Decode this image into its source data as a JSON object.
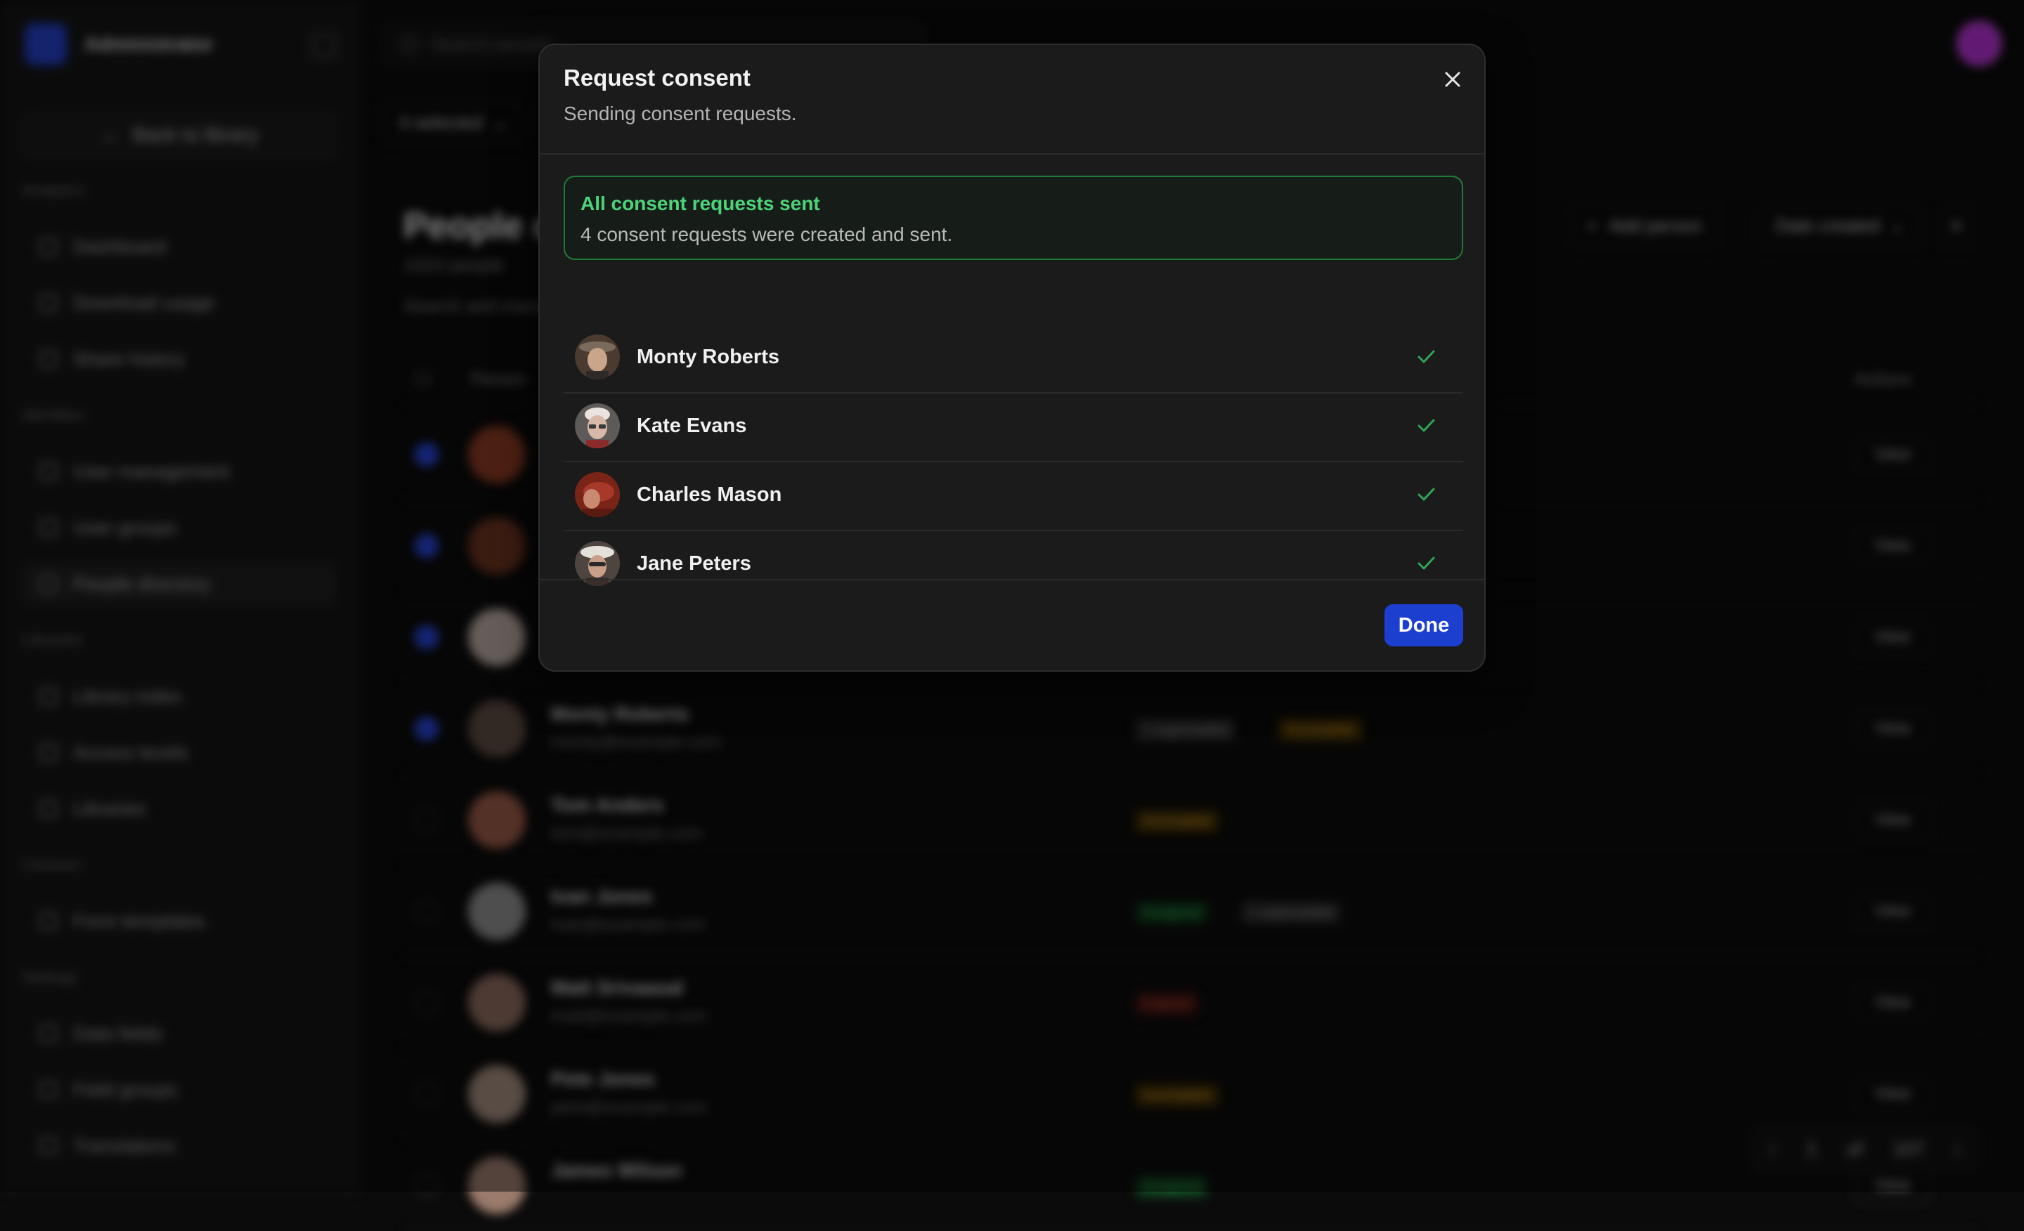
{
  "app": {
    "org_name": "Administrator",
    "back_label": "Back to library",
    "search_placeholder": "Search people",
    "selection_label": "4 selected"
  },
  "sidebar": {
    "sections": [
      {
        "title": "Analytics",
        "items": [
          "Dashboard",
          "Download usage",
          "Share history"
        ]
      },
      {
        "title": "Identities",
        "items": [
          "User management",
          "User groups",
          "People directory"
        ]
      },
      {
        "title": "Libraries",
        "items": [
          "Library index",
          "Access levels",
          "Libraries"
        ]
      },
      {
        "title": "Consent",
        "items": [
          "Form templates"
        ]
      },
      {
        "title": "Settings",
        "items": [
          "Data fields",
          "Field groups",
          "Translations"
        ]
      }
    ],
    "active_item": "People directory"
  },
  "page": {
    "title": "People directory",
    "count_text": "1024 people",
    "description": "Search and manage people",
    "add_person_label": "Add person",
    "sort_label": "Date created",
    "columns": {
      "person": "Person",
      "actions": "Actions"
    },
    "rows": [
      {
        "name": "",
        "email": "",
        "selected": true,
        "badges": []
      },
      {
        "name": "",
        "email": "",
        "selected": true,
        "badges": []
      },
      {
        "name": "",
        "email": "",
        "selected": true,
        "badges": []
      },
      {
        "name": "Monty Roberts",
        "email": "monty@example.com",
        "selected": true,
        "badges": [
          {
            "label": "1 superseded",
            "tone": "gray"
          },
          {
            "label": "Incomplete",
            "tone": "amber"
          }
        ]
      },
      {
        "name": "Tom Anders",
        "email": "tom@example.com",
        "selected": false,
        "badges": [
          {
            "label": "Incomplete",
            "tone": "amber"
          }
        ]
      },
      {
        "name": "Ivan Jones",
        "email": "ivan@example.com",
        "selected": false,
        "badges": [
          {
            "label": "Assigned",
            "tone": "green"
          },
          {
            "label": "1 superseded",
            "tone": "gray"
          }
        ]
      },
      {
        "name": "Matt Srivaasal",
        "email": "matt@example.com",
        "selected": false,
        "badges": [
          {
            "label": "Expired",
            "tone": "red"
          }
        ]
      },
      {
        "name": "Pete Jones",
        "email": "pete@example.com",
        "selected": false,
        "badges": [
          {
            "label": "Incomplete",
            "tone": "amber"
          }
        ]
      },
      {
        "name": "James Wilson",
        "email": "",
        "selected": false,
        "badges": [
          {
            "label": "Assigned",
            "tone": "green"
          }
        ]
      }
    ],
    "view_label": "View",
    "pagination": {
      "page": "1",
      "of_label": "of",
      "total_pages": "107"
    }
  },
  "modal": {
    "title": "Request consent",
    "subtitle": "Sending consent requests.",
    "success": {
      "title": "All consent requests sent",
      "message": "4 consent requests were created and sent."
    },
    "people": [
      {
        "name": "Monty Roberts",
        "status": "sent"
      },
      {
        "name": "Kate Evans",
        "status": "sent"
      },
      {
        "name": "Charles Mason",
        "status": "sent"
      },
      {
        "name": "Jane Peters",
        "status": "sent"
      }
    ],
    "done_label": "Done"
  },
  "colors": {
    "accent": "#1c3fd0",
    "success": "#4dd47a",
    "success_border": "#1f7a3a",
    "check": "#2fa457",
    "modal_bg": "#1b1b1b"
  },
  "icons": {
    "close": "close-icon",
    "check": "check-icon"
  }
}
